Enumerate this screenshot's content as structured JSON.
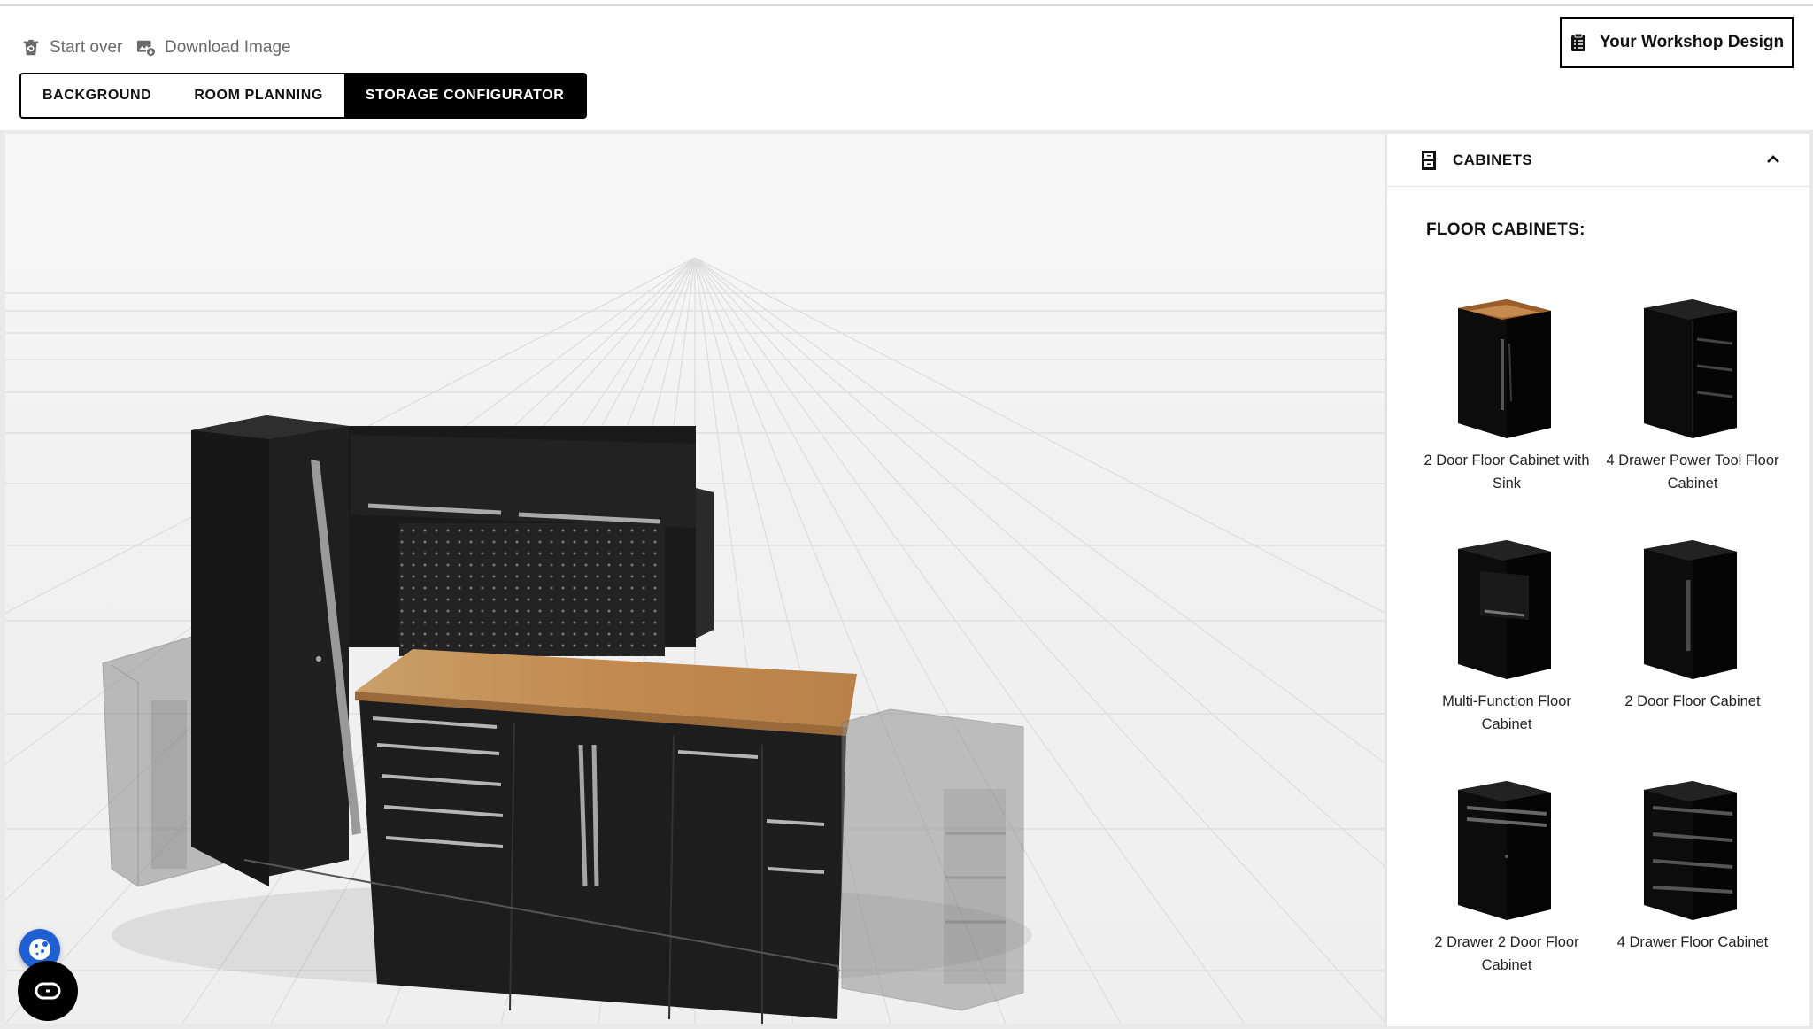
{
  "header": {
    "start_over": "Start over",
    "download_image": "Download Image",
    "design_button": "Your Workshop Design"
  },
  "tabs": [
    {
      "label": "BACKGROUND",
      "active": false
    },
    {
      "label": "ROOM PLANNING",
      "active": false
    },
    {
      "label": "STORAGE CONFIGURATOR",
      "active": true
    }
  ],
  "sidebar": {
    "panel_title": "CABINETS",
    "section_title": "FLOOR CABINETS:",
    "products": [
      {
        "label": "2 Door Floor Cabinet with Sink",
        "variant": "sink"
      },
      {
        "label": "4 Drawer Power Tool Floor Cabinet",
        "variant": "power"
      },
      {
        "label": "Multi-Function Floor Cabinet",
        "variant": "multi"
      },
      {
        "label": "2 Door Floor Cabinet",
        "variant": "door"
      },
      {
        "label": "2 Drawer 2 Door Floor Cabinet",
        "variant": "drawerdoor"
      },
      {
        "label": "4 Drawer Floor Cabinet",
        "variant": "drawers"
      }
    ]
  },
  "icons": {
    "start_over": "trash-restore-icon",
    "download": "image-download-icon",
    "design": "clipboard-list-icon",
    "panel": "cabinet-icon",
    "collapse": "chevron-up-icon",
    "cookie": "cookie-icon",
    "accessibility": "accessibility-icon"
  },
  "colors": {
    "active_tab": "#000000",
    "wood": "#c48a4e",
    "cabinet": "#1c1c1c"
  }
}
